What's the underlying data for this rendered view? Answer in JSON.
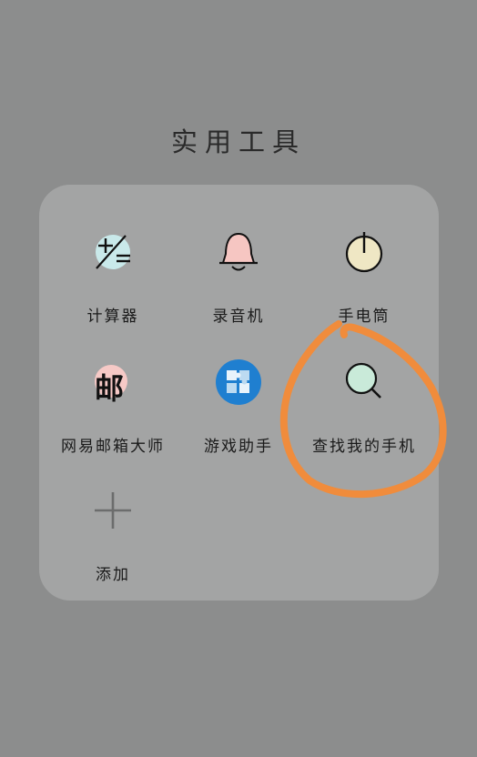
{
  "folder": {
    "title": "实用工具"
  },
  "apps": [
    {
      "label": "计算器",
      "icon": "calculator-icon"
    },
    {
      "label": "录音机",
      "icon": "bell-icon"
    },
    {
      "label": "手电筒",
      "icon": "power-icon"
    },
    {
      "label": "网易邮箱大师",
      "icon": "mail-icon",
      "glyph": "邮"
    },
    {
      "label": "游戏助手",
      "icon": "puzzle-icon"
    },
    {
      "label": "查找我的手机",
      "icon": "search-icon"
    },
    {
      "label": "添加",
      "icon": "plus-icon"
    }
  ],
  "colors": {
    "background": "#8c8d8d",
    "panel": "#a3a4a4",
    "annotation": "#f08c3c",
    "game_blue": "#1f7fd0"
  }
}
